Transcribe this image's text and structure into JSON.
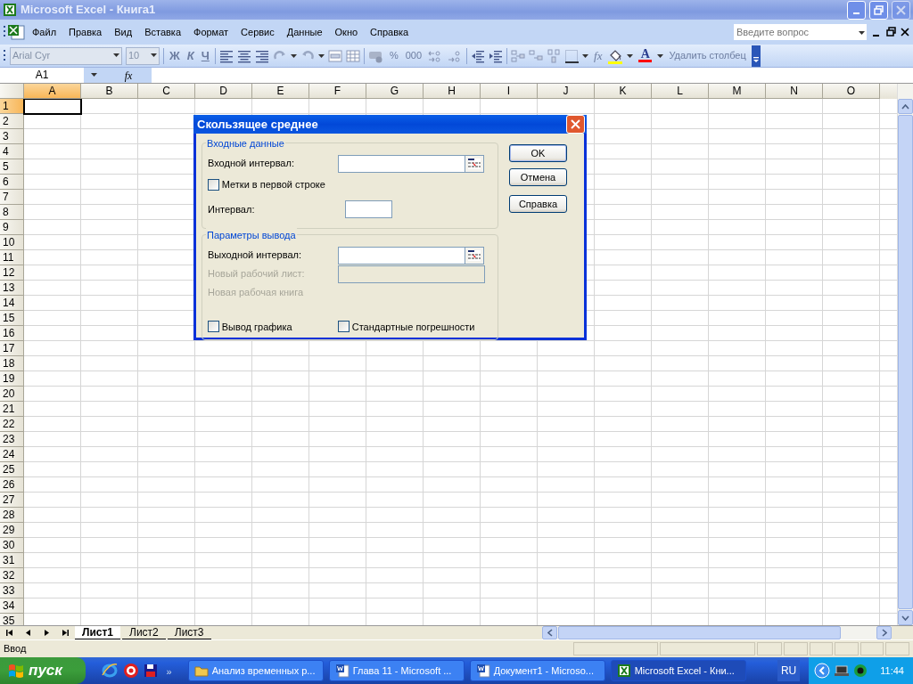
{
  "window": {
    "title": "Microsoft Excel - Книга1"
  },
  "menu": [
    "Файл",
    "Правка",
    "Вид",
    "Вставка",
    "Формат",
    "Сервис",
    "Данные",
    "Окно",
    "Справка"
  ],
  "help_search": {
    "placeholder": "Введите вопрос"
  },
  "toolbar": {
    "font": "Arial Cyr",
    "size": "10",
    "bold": "Ж",
    "italic": "К",
    "underline": "Ч",
    "percent": "%",
    "thousands": "000",
    "function": "fx",
    "font_color": "A",
    "delete_column": "Удалить столбец"
  },
  "formula_bar": {
    "name_box": "A1",
    "function": "fx"
  },
  "columns": [
    {
      "label": "A",
      "selected": true
    },
    {
      "label": "B",
      "selected": false
    },
    {
      "label": "C",
      "selected": false
    },
    {
      "label": "D",
      "selected": false
    },
    {
      "label": "E",
      "selected": false
    },
    {
      "label": "F",
      "selected": false
    },
    {
      "label": "G",
      "selected": false
    },
    {
      "label": "H",
      "selected": false
    },
    {
      "label": "I",
      "selected": false
    },
    {
      "label": "J",
      "selected": false
    },
    {
      "label": "K",
      "selected": false
    },
    {
      "label": "L",
      "selected": false
    },
    {
      "label": "M",
      "selected": false
    },
    {
      "label": "N",
      "selected": false
    },
    {
      "label": "O",
      "selected": false
    }
  ],
  "rows": [
    {
      "label": "1",
      "selected": true
    },
    {
      "label": "2",
      "selected": false
    },
    {
      "label": "3",
      "selected": false
    },
    {
      "label": "4",
      "selected": false
    },
    {
      "label": "5",
      "selected": false
    },
    {
      "label": "6",
      "selected": false
    },
    {
      "label": "7",
      "selected": false
    },
    {
      "label": "8",
      "selected": false
    },
    {
      "label": "9",
      "selected": false
    },
    {
      "label": "10",
      "selected": false
    },
    {
      "label": "11",
      "selected": false
    },
    {
      "label": "12",
      "selected": false
    },
    {
      "label": "13",
      "selected": false
    },
    {
      "label": "14",
      "selected": false
    },
    {
      "label": "15",
      "selected": false
    },
    {
      "label": "16",
      "selected": false
    },
    {
      "label": "17",
      "selected": false
    },
    {
      "label": "18",
      "selected": false
    },
    {
      "label": "19",
      "selected": false
    },
    {
      "label": "20",
      "selected": false
    },
    {
      "label": "21",
      "selected": false
    },
    {
      "label": "22",
      "selected": false
    },
    {
      "label": "23",
      "selected": false
    },
    {
      "label": "24",
      "selected": false
    },
    {
      "label": "25",
      "selected": false
    },
    {
      "label": "26",
      "selected": false
    },
    {
      "label": "27",
      "selected": false
    },
    {
      "label": "28",
      "selected": false
    },
    {
      "label": "29",
      "selected": false
    },
    {
      "label": "30",
      "selected": false
    },
    {
      "label": "31",
      "selected": false
    },
    {
      "label": "32",
      "selected": false
    },
    {
      "label": "33",
      "selected": false
    },
    {
      "label": "34",
      "selected": false
    },
    {
      "label": "35",
      "selected": false
    }
  ],
  "dialog": {
    "title": "Скользящее среднее",
    "groups": [
      {
        "legend": "Входные данные",
        "items": [
          {
            "kind": "range",
            "label": "Входной интервал:",
            "disabled": false
          },
          {
            "kind": "checkbox",
            "label": "Метки в первой строке",
            "checked": false
          },
          {
            "kind": "small",
            "label": "Интервал:",
            "disabled": false
          }
        ]
      },
      {
        "legend": "Параметры вывода",
        "items": [
          {
            "kind": "range",
            "label": "Выходной интервал:",
            "disabled": false
          },
          {
            "kind": "field",
            "label": "Новый рабочий лист:",
            "disabled": true
          },
          {
            "kind": "text",
            "label": "Новая рабочая книга",
            "disabled": true
          },
          {
            "kind": "checkpair",
            "checkboxes": [
              {
                "label": "Вывод графика",
                "checked": false
              },
              {
                "label": "Стандартные погрешности",
                "checked": false
              }
            ]
          }
        ]
      }
    ],
    "buttons": [
      {
        "label": "OK",
        "default": true
      },
      {
        "label": "Отмена",
        "default": false
      },
      {
        "label": "Справка",
        "default": false
      }
    ]
  },
  "sheet_tabs": [
    {
      "label": "Лист1",
      "selected": true
    },
    {
      "label": "Лист2",
      "selected": false
    },
    {
      "label": "Лист3",
      "selected": false
    }
  ],
  "status_bar": {
    "text": "Ввод"
  },
  "taskbar": {
    "start": "пуск",
    "more": "»",
    "buttons": [
      {
        "kind": "folder",
        "label": "Анализ временных р...",
        "selected": false
      },
      {
        "kind": "word",
        "label": "Глава 11 - Microsoft ...",
        "selected": false
      },
      {
        "kind": "word",
        "label": "Документ1 - Microso...",
        "selected": false
      },
      {
        "kind": "excel",
        "label": "Microsoft Excel - Кни...",
        "selected": true
      }
    ],
    "language": "RU",
    "clock": "11:44"
  }
}
